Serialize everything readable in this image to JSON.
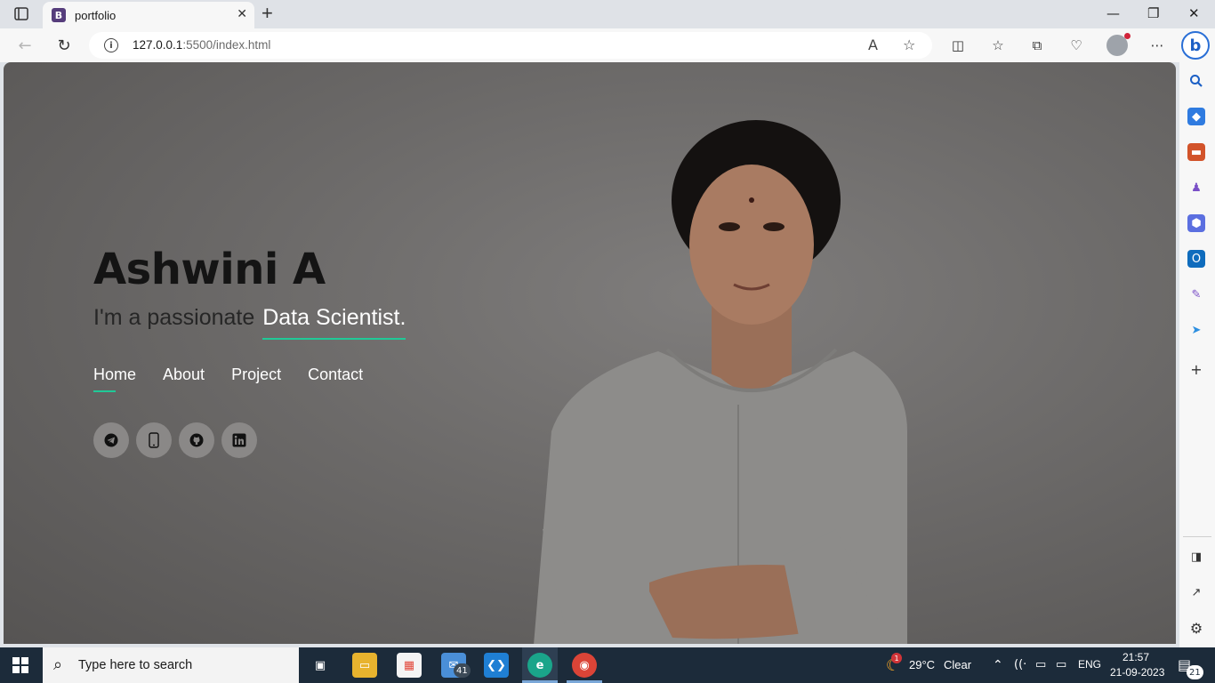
{
  "browser": {
    "tab_title": "portfolio",
    "tab_favicon_letter": "B",
    "url_host": "127.0.0.1",
    "url_rest": ":5500/index.html",
    "bing_letter": "b"
  },
  "page": {
    "name": "Ashwini A",
    "tagline_prefix": "I'm a passionate",
    "tagline_role": "Data Scientist.",
    "nav": [
      {
        "label": "Home",
        "active": true
      },
      {
        "label": "About",
        "active": false
      },
      {
        "label": "Project",
        "active": false
      },
      {
        "label": "Contact",
        "active": false
      }
    ],
    "socials": [
      "telegram-icon",
      "phone-icon",
      "github-icon",
      "linkedin-icon"
    ],
    "accent_color": "#20c997"
  },
  "taskbar": {
    "search_placeholder": "Type here to search",
    "mail_badge": "41",
    "weather_badge": "1",
    "temperature": "29°C",
    "weather": "Clear",
    "language": "ENG",
    "time": "21:57",
    "date": "21-09-2023",
    "notification_count": "21"
  }
}
